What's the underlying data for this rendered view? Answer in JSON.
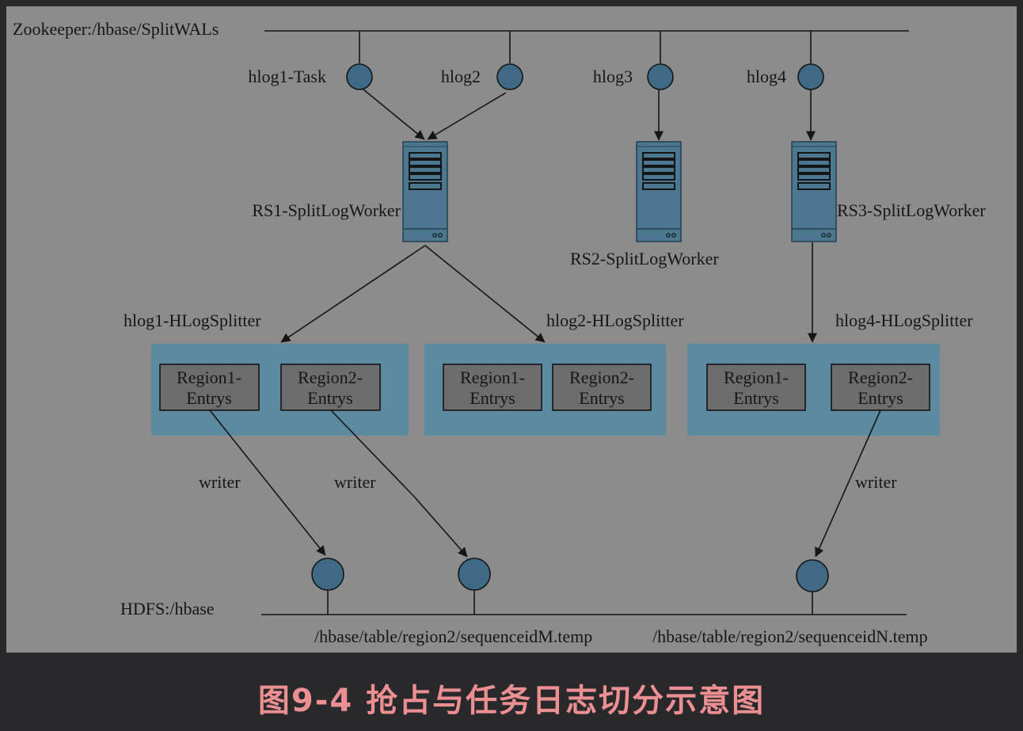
{
  "zookeeper": {
    "label": "Zookeeper:/hbase/SplitWALs"
  },
  "tasks": [
    {
      "label": "hlog1-Task"
    },
    {
      "label": "hlog2"
    },
    {
      "label": "hlog3"
    },
    {
      "label": "hlog4"
    }
  ],
  "workers": [
    {
      "label": "RS1-SplitLogWorker"
    },
    {
      "label": "RS2-SplitLogWorker"
    },
    {
      "label": "RS3-SplitLogWorker"
    }
  ],
  "splitters": [
    {
      "label": "hlog1-HLogSplitter",
      "regions": [
        {
          "line1": "Region1-",
          "line2": "Entrys"
        },
        {
          "line1": "Region2-",
          "line2": "Entrys"
        }
      ]
    },
    {
      "label": "hlog2-HLogSplitter",
      "regions": [
        {
          "line1": "Region1-",
          "line2": "Entrys"
        },
        {
          "line1": "Region2-",
          "line2": "Entrys"
        }
      ]
    },
    {
      "label": "hlog4-HLogSplitter",
      "regions": [
        {
          "line1": "Region1-",
          "line2": "Entrys"
        },
        {
          "line1": "Region2-",
          "line2": "Entrys"
        }
      ]
    }
  ],
  "writer_labels": [
    "writer",
    "writer",
    "writer"
  ],
  "hdfs": {
    "label": "HDFS:/hbase",
    "paths": [
      "/hbase/table/region2/sequenceidM.temp",
      "/hbase/table/region2/sequenceidN.temp"
    ]
  },
  "caption": "图9-4 抢占与任务日志切分示意图",
  "colors": {
    "canvas": "#8c8c8c",
    "page_bg": "#29292b",
    "node_fill": "#3f6a85",
    "server_fill": "#4b7890",
    "splitter_box": "#5c8aa1",
    "region_box": "#6d6d6d",
    "line": "#151515",
    "caption": "#ec8f92"
  }
}
